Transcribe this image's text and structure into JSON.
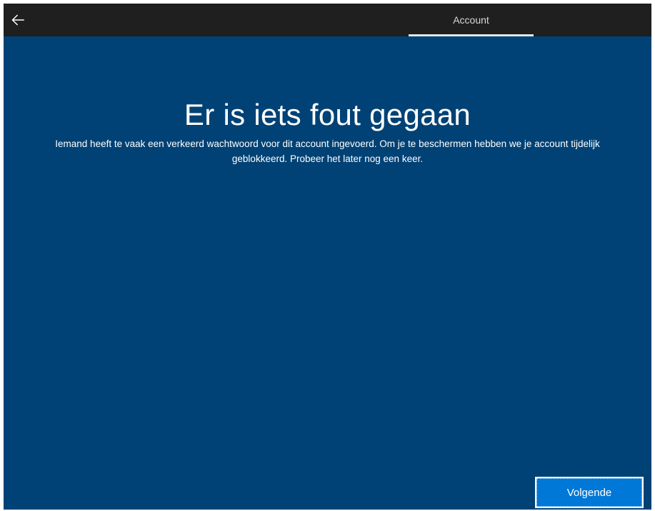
{
  "header": {
    "back_icon": "arrow-left-icon",
    "tab_label": "Account"
  },
  "main": {
    "title": "Er is iets fout gegaan",
    "message": "Iemand heeft te vaak een verkeerd wachtwoord voor dit account ingevoerd. Om je te beschermen hebben we je account tijdelijk geblokkeerd. Probeer het later nog een keer."
  },
  "footer": {
    "next_label": "Volgende"
  },
  "colors": {
    "background": "#004275",
    "topbar": "#1f1f1f",
    "accent_button": "#0078d7",
    "text": "#ffffff"
  }
}
